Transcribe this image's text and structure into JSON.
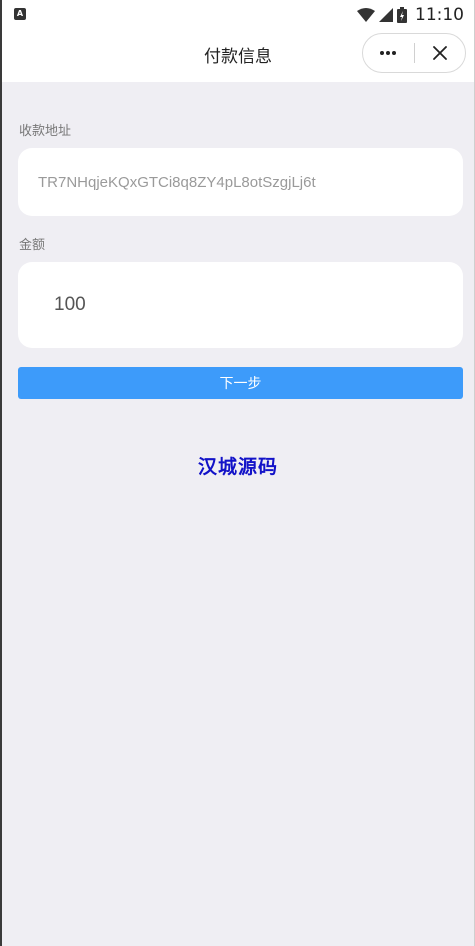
{
  "status_bar": {
    "time": "11:10",
    "notification_icon": "app-notification-icon",
    "icons": [
      "wifi-icon",
      "signal-icon",
      "battery-icon"
    ]
  },
  "nav": {
    "title": "付款信息",
    "more_icon": "more-dots-icon",
    "close_icon": "close-icon"
  },
  "form": {
    "address_label": "收款地址",
    "address_value": "TR7NHqjeKQxGTCi8q8ZY4pL8otSzgjLj6t",
    "amount_label": "金额",
    "amount_value": "100",
    "next_label": "下一步"
  },
  "watermark": "汉城源码",
  "colors": {
    "background": "#efeef3",
    "primary_button": "#3d9bfa",
    "watermark": "#1212c8"
  }
}
